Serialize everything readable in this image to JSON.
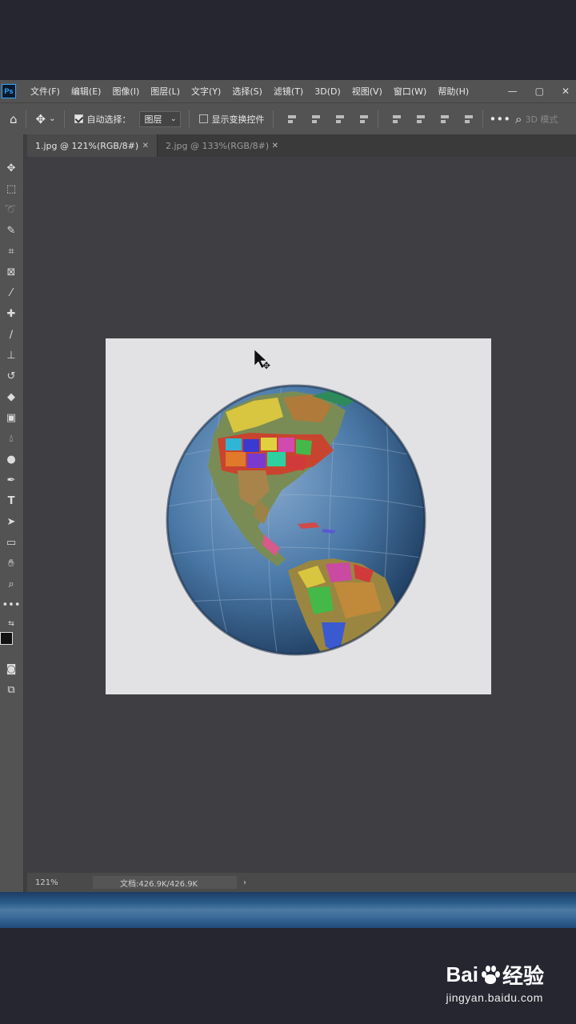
{
  "app": {
    "logo": "Ps",
    "menu": [
      "文件(F)",
      "编辑(E)",
      "图像(I)",
      "图层(L)",
      "文字(Y)",
      "选择(S)",
      "滤镜(T)",
      "3D(D)",
      "视图(V)",
      "窗口(W)",
      "帮助(H)"
    ],
    "window_controls": [
      "—",
      "▢",
      "✕"
    ]
  },
  "options_bar": {
    "auto_select_label": "自动选择：",
    "auto_select_checked": true,
    "auto_select_target": "图层",
    "show_transform_label": "显示变换控件",
    "show_transform_checked": false,
    "mode_3d_label": "3D 模式"
  },
  "tabs": [
    {
      "label": "1.jpg @ 121%(RGB/8#)",
      "active": true
    },
    {
      "label": "2.jpg @ 133%(RGB/8#)",
      "active": false
    }
  ],
  "tools": [
    "move-tool",
    "marquee-tool",
    "lasso-tool",
    "quick-select-tool",
    "crop-tool",
    "frame-tool",
    "eyedropper-tool",
    "healing-brush-tool",
    "brush-tool",
    "clone-stamp-tool",
    "history-brush-tool",
    "eraser-tool",
    "gradient-tool",
    "blur-tool",
    "dodge-tool",
    "pen-tool",
    "type-tool",
    "path-select-tool",
    "rectangle-tool",
    "hand-tool",
    "zoom-tool",
    "more-tools"
  ],
  "status": {
    "zoom": "121%",
    "doc_size": "文档:426.9K/426.9K",
    "arrow": "›"
  },
  "canvas": {
    "image_description": "globe"
  },
  "watermark": {
    "brand": "Bai",
    "brand_tail": "经验",
    "url": "jingyan.baidu.com"
  },
  "colors": {
    "accent": "#31a8ff",
    "panel": "#535353",
    "workspace": "#3f3e42"
  }
}
